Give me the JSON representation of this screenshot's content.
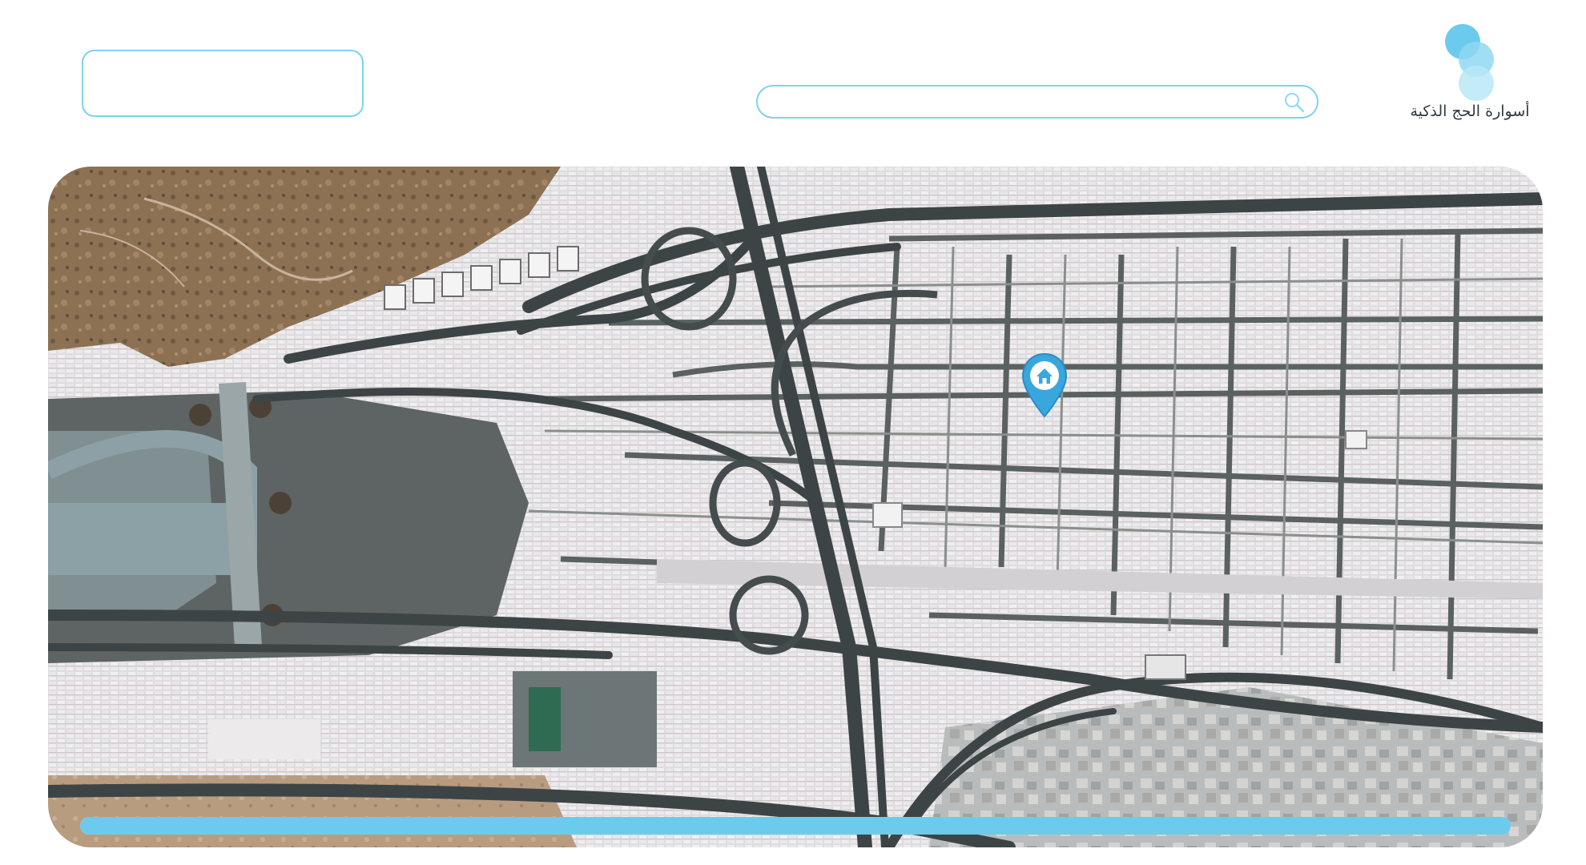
{
  "header": {
    "app_name": "أسوارة الحج الذكية",
    "logo_icon": "bubbles-logo-icon",
    "accent_color": "#6ccbec"
  },
  "info_box": {
    "value": ""
  },
  "search": {
    "value": "",
    "placeholder": "",
    "icon": "search-icon"
  },
  "map": {
    "type": "satellite",
    "marker": {
      "icon": "home-pin-icon",
      "color": "#3aa6de"
    }
  },
  "progress": {
    "fraction": 1.0
  }
}
